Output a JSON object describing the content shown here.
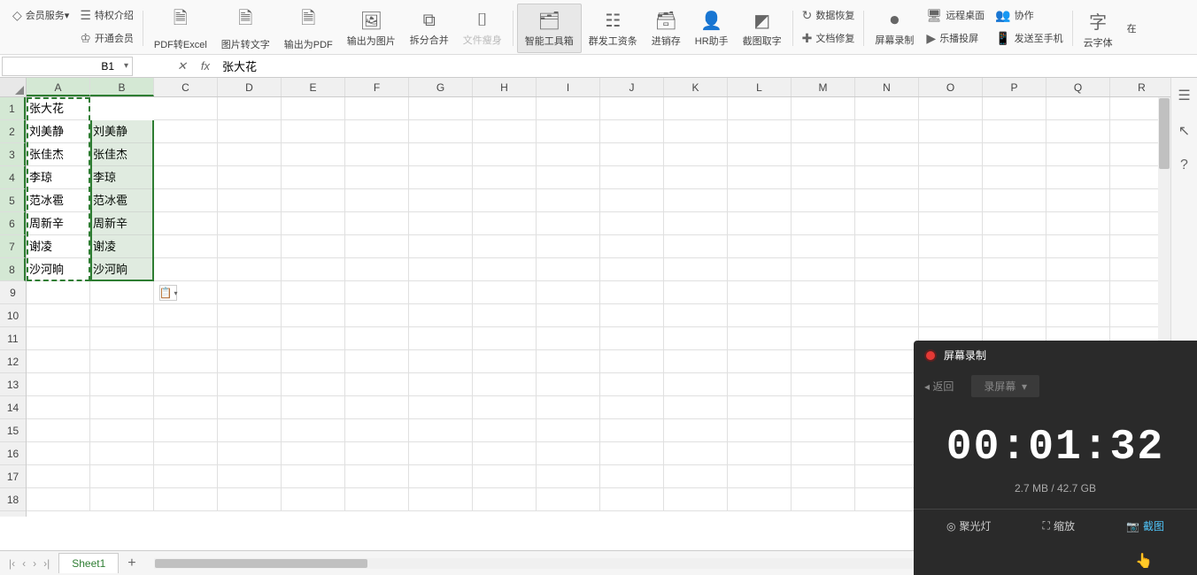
{
  "toolbar": {
    "member_service": "会员服务",
    "privilege_intro": "特权介绍",
    "open_member": "开通会员",
    "pdf_to_excel": "PDF转Excel",
    "image_to_text": "图片转文字",
    "export_pdf": "输出为PDF",
    "export_image": "输出为图片",
    "split_merge": "拆分合并",
    "file_slim": "文件瘦身",
    "smart_toolbox": "智能工具箱",
    "mass_resource": "群发工资条",
    "clear_inventory": "进销存",
    "hr_assistant": "HR助手",
    "screenshot_text": "截图取字",
    "data_recovery": "数据恢复",
    "doc_repair": "文档修复",
    "screen_record": "屏幕录制",
    "remote_desktop": "远程桌面",
    "le_cast": "乐播投屏",
    "collaborate": "协作",
    "send_to_phone": "发送至手机",
    "cloud_font": "云字体",
    "online": "在"
  },
  "name_box": "B1",
  "formula": "张大花",
  "columns": [
    "A",
    "B",
    "C",
    "D",
    "E",
    "F",
    "G",
    "H",
    "I",
    "J",
    "K",
    "L",
    "M",
    "N",
    "O",
    "P",
    "Q",
    "R"
  ],
  "rows": [
    1,
    2,
    3,
    4,
    5,
    6,
    7,
    8,
    9,
    10,
    11,
    12,
    13,
    14,
    15,
    16,
    17,
    18
  ],
  "data_a": [
    "张大花",
    "刘美静",
    "张佳杰",
    "李琼",
    "范冰雹",
    "周新辛",
    "谢凌",
    "沙河晌"
  ],
  "data_b": [
    "张大花",
    "刘美静",
    "张佳杰",
    "李琼",
    "范冰雹",
    "周新辛",
    "谢凌",
    "沙河晌"
  ],
  "sheet_name": "Sheet1",
  "recorder": {
    "title": "屏幕录制",
    "back": "返回",
    "mode": "录屏幕",
    "timer": "00:01:32",
    "storage": "2.7 MB / 42.7 GB",
    "spotlight": "聚光灯",
    "zoom": "缩放",
    "screenshot": "截图"
  }
}
